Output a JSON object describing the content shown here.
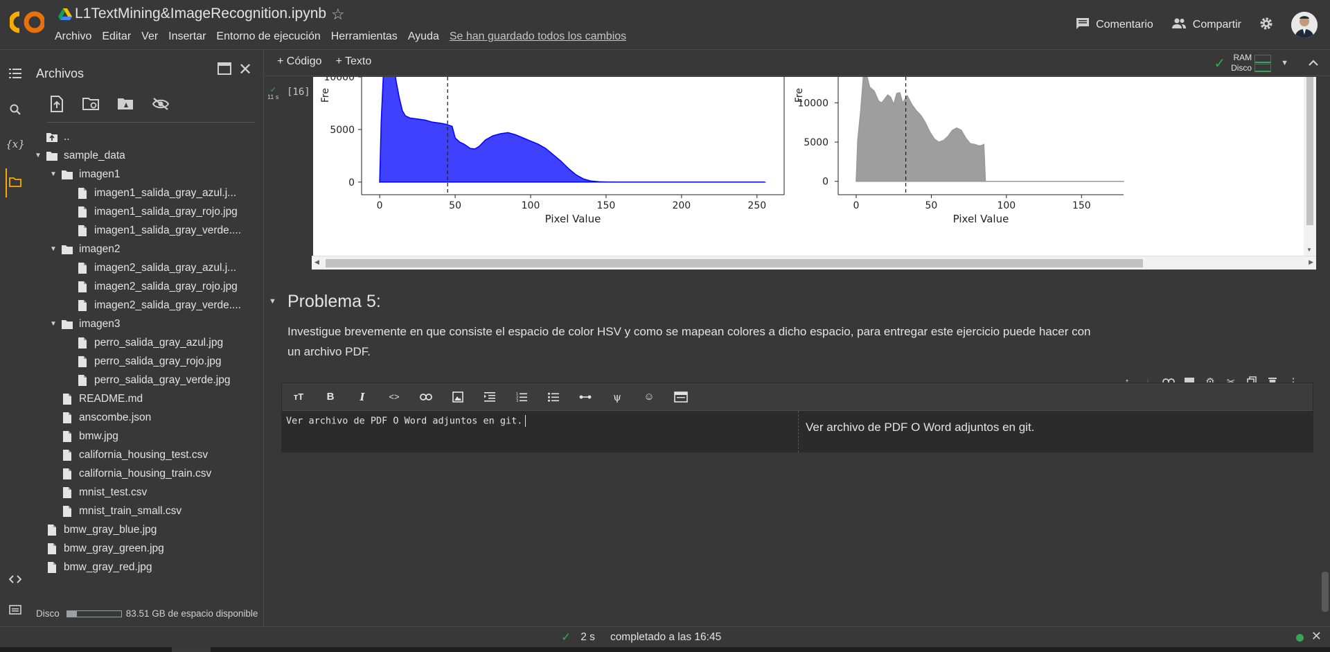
{
  "header": {
    "title": "L1TextMining&ImageRecognition.ipynb",
    "menu": [
      "Archivo",
      "Editar",
      "Ver",
      "Insertar",
      "Entorno de ejecución",
      "Herramientas",
      "Ayuda"
    ],
    "saved_status": "Se han guardado todos los cambios",
    "comment_label": "Comentario",
    "share_label": "Compartir"
  },
  "toolbar": {
    "add_code": "+ Código",
    "add_text": "+ Texto",
    "ram_label": "RAM",
    "disk_label": "Disco"
  },
  "sidebar": {
    "title": "Archivos",
    "tree": [
      {
        "label": "..",
        "type": "up",
        "depth": 0
      },
      {
        "label": "sample_data",
        "type": "folder",
        "depth": 0,
        "open": true
      },
      {
        "label": "imagen1",
        "type": "folder",
        "depth": 1,
        "open": true
      },
      {
        "label": "imagen1_salida_gray_azul.j...",
        "type": "file",
        "depth": 2
      },
      {
        "label": "imagen1_salida_gray_rojo.jpg",
        "type": "file",
        "depth": 2
      },
      {
        "label": "imagen1_salida_gray_verde....",
        "type": "file",
        "depth": 2
      },
      {
        "label": "imagen2",
        "type": "folder",
        "depth": 1,
        "open": true
      },
      {
        "label": "imagen2_salida_gray_azul.j...",
        "type": "file",
        "depth": 2
      },
      {
        "label": "imagen2_salida_gray_rojo.jpg",
        "type": "file",
        "depth": 2
      },
      {
        "label": "imagen2_salida_gray_verde....",
        "type": "file",
        "depth": 2
      },
      {
        "label": "imagen3",
        "type": "folder",
        "depth": 1,
        "open": true
      },
      {
        "label": "perro_salida_gray_azul.jpg",
        "type": "file",
        "depth": 2
      },
      {
        "label": "perro_salida_gray_rojo.jpg",
        "type": "file",
        "depth": 2
      },
      {
        "label": "perro_salida_gray_verde.jpg",
        "type": "file",
        "depth": 2
      },
      {
        "label": "README.md",
        "type": "file",
        "depth": 1
      },
      {
        "label": "anscombe.json",
        "type": "file",
        "depth": 1
      },
      {
        "label": "bmw.jpg",
        "type": "file",
        "depth": 1
      },
      {
        "label": "california_housing_test.csv",
        "type": "file",
        "depth": 1
      },
      {
        "label": "california_housing_train.csv",
        "type": "file",
        "depth": 1
      },
      {
        "label": "mnist_test.csv",
        "type": "file",
        "depth": 1
      },
      {
        "label": "mnist_train_small.csv",
        "type": "file",
        "depth": 1
      },
      {
        "label": "bmw_gray_blue.jpg",
        "type": "file",
        "depth": 0
      },
      {
        "label": "bmw_gray_green.jpg",
        "type": "file",
        "depth": 0
      },
      {
        "label": "bmw_gray_red.jpg",
        "type": "file",
        "depth": 0
      }
    ],
    "disk_label": "Disco",
    "disk_used_fraction": 0.18,
    "disk_free": "83.51 GB de espacio disponible"
  },
  "output_cell": {
    "exec_count": "[16]",
    "exec_time": "11 s"
  },
  "chart_data": [
    {
      "type": "area",
      "ylabel": "Fre",
      "xlabel": "Pixel Value",
      "color": "#0000ff",
      "xticks": [
        0,
        50,
        100,
        150,
        200,
        250
      ],
      "yticks": [
        0,
        5000,
        10000
      ],
      "xlim": [
        -12,
        268
      ],
      "ylim_visible": [
        -1200,
        10000
      ],
      "dashed_line_x": 45,
      "x": [
        0,
        1,
        3,
        5,
        7,
        9,
        11,
        13,
        15,
        17,
        20,
        25,
        30,
        35,
        40,
        44,
        48,
        50,
        53,
        56,
        60,
        63,
        66,
        70,
        75,
        80,
        85,
        90,
        95,
        100,
        105,
        110,
        115,
        120,
        125,
        130,
        135,
        140,
        145,
        150,
        160,
        180,
        200,
        255
      ],
      "y": [
        0,
        5800,
        12000,
        14000,
        13000,
        11500,
        9500,
        8000,
        6800,
        6300,
        6100,
        6000,
        5900,
        5700,
        5600,
        5500,
        5300,
        4200,
        3800,
        3600,
        3200,
        3150,
        3400,
        4000,
        4400,
        4600,
        4700,
        4500,
        4200,
        3900,
        3600,
        3200,
        2600,
        2000,
        1300,
        700,
        300,
        100,
        30,
        10,
        0,
        0,
        0,
        0
      ]
    },
    {
      "type": "area",
      "ylabel": "Fre",
      "xlabel": "Pixel Value",
      "color": "#999999",
      "xticks": [
        0,
        50,
        100,
        150
      ],
      "yticks": [
        0,
        5000,
        10000
      ],
      "xlim": [
        -12,
        178
      ],
      "ylim_visible": [
        -1700,
        13300
      ],
      "dashed_line_x": 33,
      "x": [
        0,
        1,
        3,
        5,
        7,
        9,
        12,
        15,
        17,
        19,
        21,
        23,
        25,
        27,
        29,
        31,
        34,
        37,
        40,
        43,
        46,
        49,
        52,
        55,
        58,
        61,
        64,
        67,
        70,
        73,
        76,
        79,
        82,
        84,
        85,
        86,
        88,
        100,
        178
      ],
      "y": [
        0,
        5200,
        9000,
        14000,
        13500,
        12000,
        11500,
        10200,
        10000,
        10500,
        11000,
        10700,
        9800,
        11200,
        11300,
        10000,
        10900,
        9800,
        9000,
        8400,
        7500,
        6300,
        5400,
        5000,
        5200,
        5700,
        6500,
        6800,
        6500,
        5500,
        4800,
        4700,
        4500,
        4600,
        4700,
        0,
        0,
        0,
        0
      ]
    }
  ],
  "markdown_cell": {
    "heading": "Problema 5:",
    "body": "Investigue brevemente en que consiste el espacio de color HSV y como se mapean colores a dicho espacio, para entregar este ejercicio puede hacer con un archivo PDF."
  },
  "edit_cell": {
    "source": "Ver archivo de PDF O Word adjuntos en git.",
    "preview": "Ver archivo de PDF O Word adjuntos en git."
  },
  "status_bar": {
    "duration": "2 s",
    "completed": "completado a las 16:45"
  },
  "colors": {
    "accent": "#f9ab00",
    "success": "#34a853",
    "background": "#383838"
  }
}
